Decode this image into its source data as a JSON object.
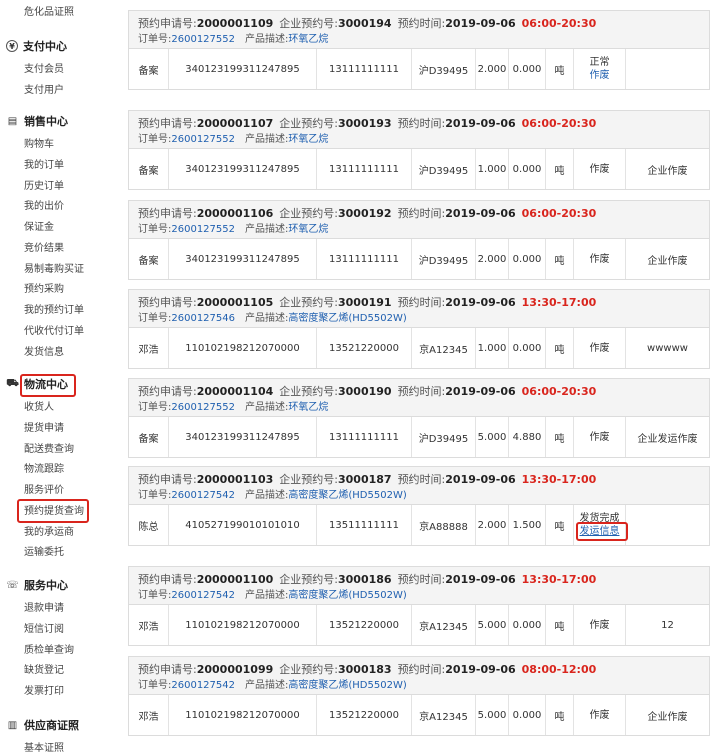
{
  "sidebar": {
    "top_link": "危化品证照",
    "sections": [
      {
        "title": "支付中心",
        "icon": "yen-circle-icon",
        "items": [
          "支付会员",
          "支付用户"
        ]
      },
      {
        "title": "销售中心",
        "icon": "sales-icon",
        "items": [
          "购物车",
          "我的订单",
          "历史订单",
          "我的出价",
          "保证金",
          "竞价结果",
          "易制毒购买证",
          "预约采购",
          "我的预约订单",
          "代收代付订单",
          "发货信息"
        ]
      },
      {
        "title": "物流中心",
        "icon": "truck-icon",
        "items": [
          "收货人",
          "提货申请",
          "配送费查询",
          "物流跟踪",
          "服务评价",
          "预约提货查询",
          "我的承运商",
          "运输委托"
        ]
      },
      {
        "title": "服务中心",
        "icon": "headset-icon",
        "items": [
          "退款申请",
          "短信订阅",
          "质检单查询",
          "缺货登记",
          "发票打印"
        ]
      },
      {
        "title": "供应商证照",
        "icon": "certificate-icon",
        "items": [
          "基本证照"
        ]
      }
    ]
  },
  "labels": {
    "apply_no": "预约申请号:",
    "company_no": "企业预约号:",
    "time": "预约时间:",
    "order_no": "订单号:",
    "product": "产品描述:"
  },
  "orders": [
    {
      "apply_no": "2000001109",
      "company_no": "3000194",
      "date": "2019-09-06",
      "time_range": "06:00-20:30",
      "order_no": "2600127552",
      "product": "环氧乙烷",
      "row": {
        "name": "备案",
        "id_no": "340123199311247895",
        "phone": "13111111111",
        "plate": "沪D39495",
        "qty1": "2.000",
        "qty2": "0.000",
        "unit": "吨",
        "status": "正常",
        "status_link": "作废",
        "remark": ""
      }
    },
    {
      "apply_no": "2000001107",
      "company_no": "3000193",
      "date": "2019-09-06",
      "time_range": "06:00-20:30",
      "order_no": "2600127552",
      "product": "环氧乙烷",
      "row": {
        "name": "备案",
        "id_no": "340123199311247895",
        "phone": "13111111111",
        "plate": "沪D39495",
        "qty1": "1.000",
        "qty2": "0.000",
        "unit": "吨",
        "status": "作废",
        "status_link": "",
        "remark": "企业作废"
      }
    },
    {
      "apply_no": "2000001106",
      "company_no": "3000192",
      "date": "2019-09-06",
      "time_range": "06:00-20:30",
      "order_no": "2600127552",
      "product": "环氧乙烷",
      "row": {
        "name": "备案",
        "id_no": "340123199311247895",
        "phone": "13111111111",
        "plate": "沪D39495",
        "qty1": "2.000",
        "qty2": "0.000",
        "unit": "吨",
        "status": "作废",
        "status_link": "",
        "remark": "企业作废"
      }
    },
    {
      "apply_no": "2000001105",
      "company_no": "3000191",
      "date": "2019-09-06",
      "time_range": "13:30-17:00",
      "order_no": "2600127546",
      "product": "高密度聚乙烯(HD5502W)",
      "row": {
        "name": "邓浩",
        "id_no": "110102198212070000",
        "phone": "13521220000",
        "plate": "京A12345",
        "qty1": "1.000",
        "qty2": "0.000",
        "unit": "吨",
        "status": "作废",
        "status_link": "",
        "remark": "wwwww"
      }
    },
    {
      "apply_no": "2000001104",
      "company_no": "3000190",
      "date": "2019-09-06",
      "time_range": "06:00-20:30",
      "order_no": "2600127552",
      "product": "环氧乙烷",
      "row": {
        "name": "备案",
        "id_no": "340123199311247895",
        "phone": "13111111111",
        "plate": "沪D39495",
        "qty1": "5.000",
        "qty2": "4.880",
        "unit": "吨",
        "status": "作废",
        "status_link": "",
        "remark": "企业发运作废"
      }
    },
    {
      "apply_no": "2000001103",
      "company_no": "3000187",
      "date": "2019-09-06",
      "time_range": "13:30-17:00",
      "order_no": "2600127542",
      "product": "高密度聚乙烯(HD5502W)",
      "row": {
        "name": "陈总",
        "id_no": "410527199010101010",
        "phone": "13511111111",
        "plate": "京A88888",
        "qty1": "2.000",
        "qty2": "1.500",
        "unit": "吨",
        "status": "发货完成",
        "status_link": "发运信息",
        "remark": ""
      }
    },
    {
      "apply_no": "2000001100",
      "company_no": "3000186",
      "date": "2019-09-06",
      "time_range": "13:30-17:00",
      "order_no": "2600127542",
      "product": "高密度聚乙烯(HD5502W)",
      "row": {
        "name": "邓浩",
        "id_no": "110102198212070000",
        "phone": "13521220000",
        "plate": "京A12345",
        "qty1": "5.000",
        "qty2": "0.000",
        "unit": "吨",
        "status": "作废",
        "status_link": "",
        "remark": "12"
      }
    },
    {
      "apply_no": "2000001099",
      "company_no": "3000183",
      "date": "2019-09-06",
      "time_range": "08:00-12:00",
      "order_no": "2600127542",
      "product": "高密度聚乙烯(HD5502W)",
      "row": {
        "name": "邓浩",
        "id_no": "110102198212070000",
        "phone": "13521220000",
        "plate": "京A12345",
        "qty1": "5.000",
        "qty2": "0.000",
        "unit": "吨",
        "status": "作废",
        "status_link": "",
        "remark": "企业作废"
      }
    }
  ],
  "colors": {
    "accent_red": "#d9251d",
    "link_blue": "#2060b0",
    "header_gray": "#f4f4f4"
  }
}
